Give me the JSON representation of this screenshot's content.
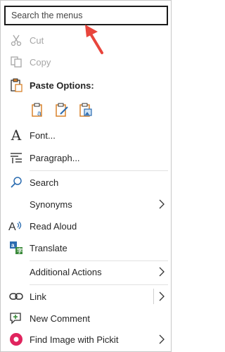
{
  "search": {
    "placeholder": "Search the menus"
  },
  "items": {
    "cut": "Cut",
    "copy": "Copy",
    "paste_options": "Paste Options:",
    "font": "Font...",
    "paragraph": "Paragraph...",
    "search": "Search",
    "synonyms": "Synonyms",
    "read_aloud": "Read Aloud",
    "translate": "Translate",
    "additional_actions": "Additional Actions",
    "link": "Link",
    "new_comment": "New Comment",
    "find_image": "Find Image with Pickit"
  },
  "colors": {
    "accent_arrow": "#e8453c",
    "icon_blue": "#2b6cb0",
    "icon_orange": "#d9822b",
    "icon_pink": "#e0245e"
  }
}
